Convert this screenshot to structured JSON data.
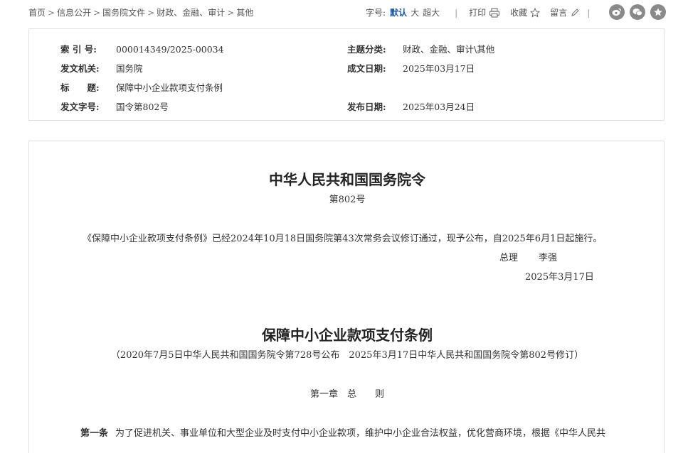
{
  "breadcrumb": {
    "items": [
      "首页",
      "信息公开",
      "国务院文件",
      "财政、金融、审计",
      "其他"
    ],
    "separator": ">"
  },
  "toolbar": {
    "font_size_label": "字号:",
    "font_default": "默认",
    "font_large": "大",
    "font_xlarge": "超大",
    "divider": "|",
    "print_label": "打印",
    "favorite_label": "收藏",
    "comment_label": "留言"
  },
  "social": [
    "weibo-icon",
    "wechat-icon",
    "qzone-icon"
  ],
  "info": {
    "index_no_label": "索 引 号:",
    "index_no": "000014349/2025-00034",
    "topic_label": "主题分类:",
    "topic": "财政、金融、审计\\其他",
    "issuer_label": "发文机关:",
    "issuer": "国务院",
    "written_date_label": "成文日期:",
    "written_date": "2025年03月17日",
    "title_label": "标　　题:",
    "title": "保障中小企业款项支付条例",
    "doc_no_label": "发文字号:",
    "doc_no": "国令第802号",
    "publish_date_label": "发布日期:",
    "publish_date": "2025年03月24日"
  },
  "document": {
    "order_title": "中华人民共和国国务院令",
    "order_no": "第802号",
    "order_body": "《保障中小企业款项支付条例》已经2024年10月18日国务院第43次常务会议修订通过，现予公布，自2025年6月1日起施行。",
    "signer_title": "总理",
    "signer_name": "李强",
    "sign_date": "2025年3月17日",
    "reg_title": "保障中小企业款项支付条例",
    "reg_note": "（2020年7月5日中华人民共和国国务院令第728号公布　2025年3月17日中华人民共和国国务院令第802号修订）",
    "chapter": "第一章　总　　则",
    "article_no": "第一条",
    "article_text": "为了促进机关、事业单位和大型企业及时支付中小企业款项，维护中小企业合法权益，优化营商环境，根据《中华人民共"
  }
}
